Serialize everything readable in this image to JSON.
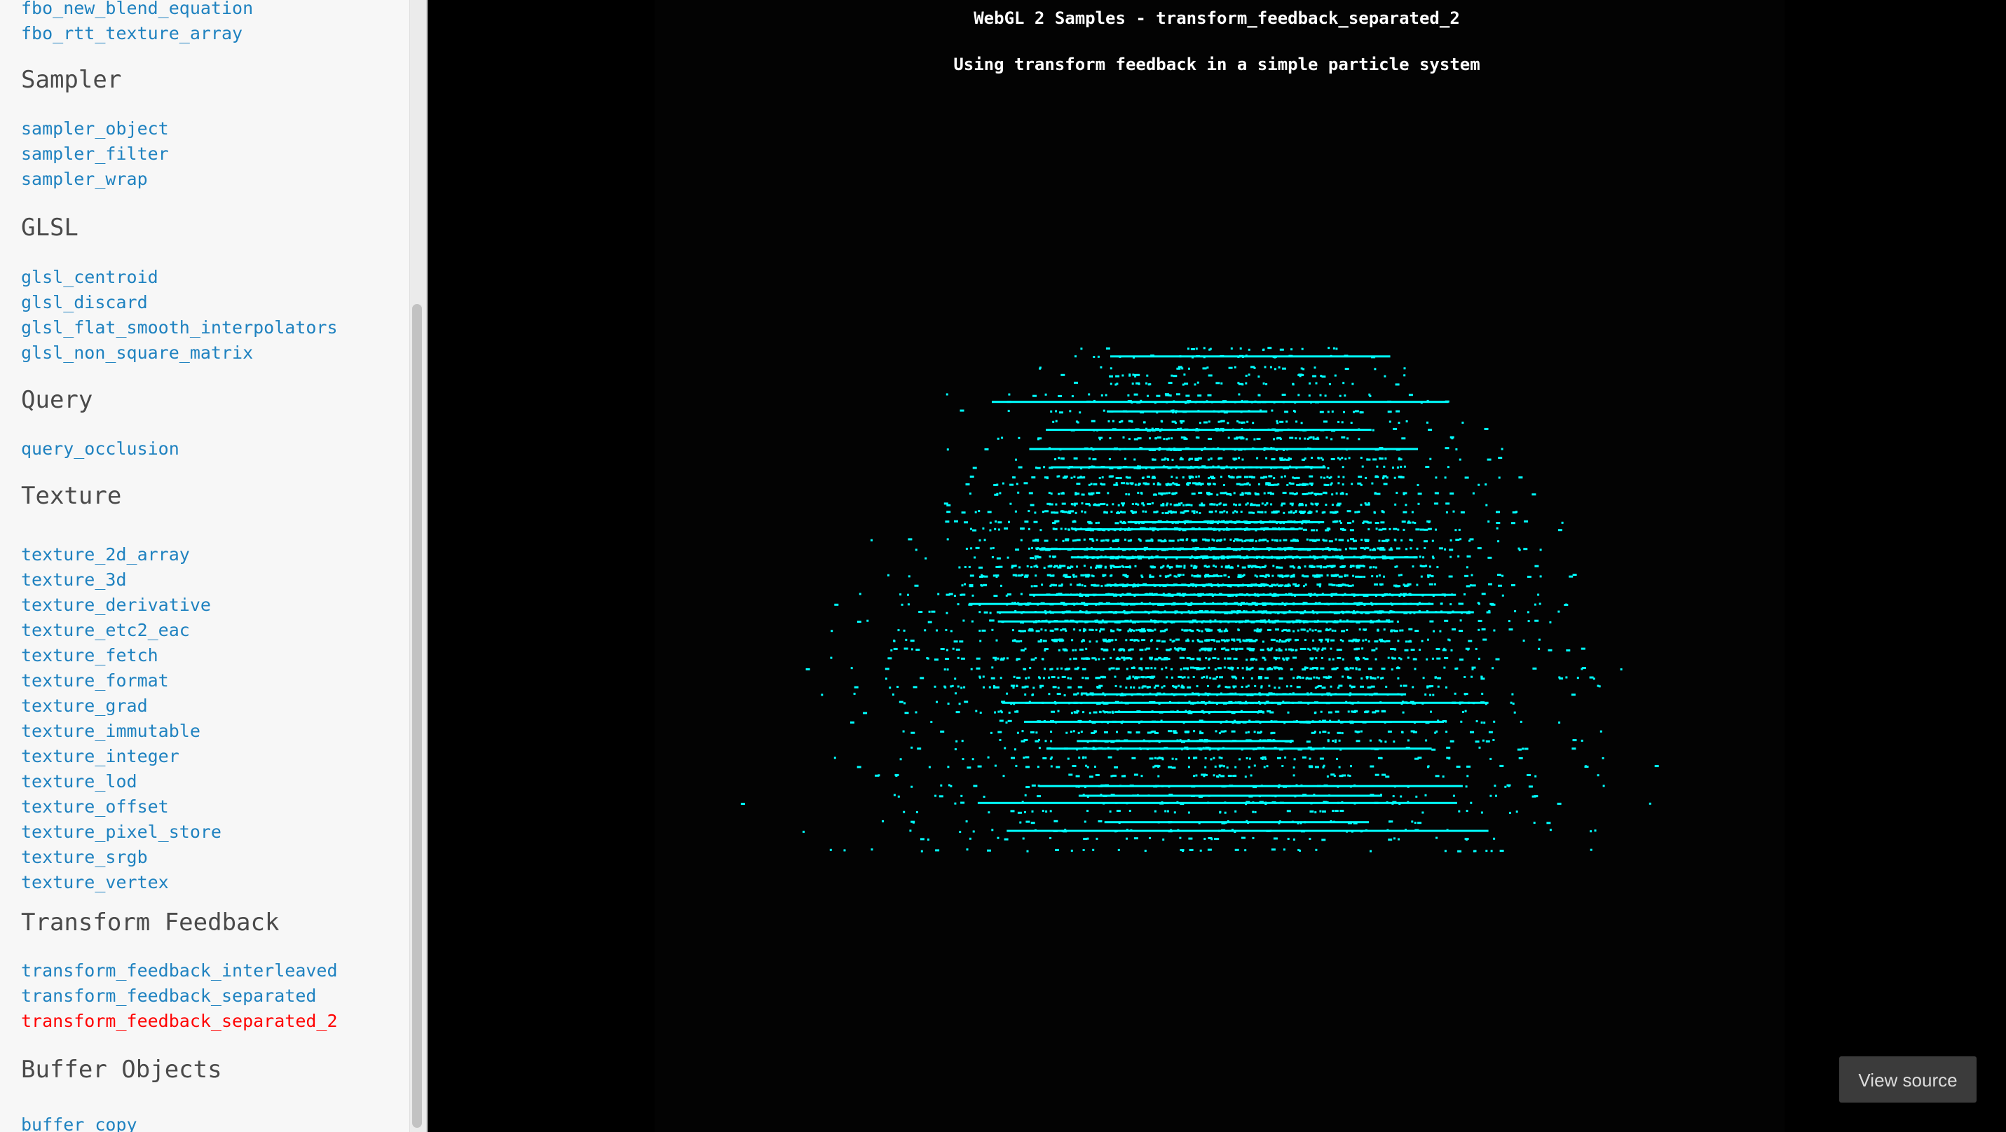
{
  "sidebar": {
    "sections": [
      {
        "title": "",
        "items": [
          {
            "label": "fbo_new_blend_equation",
            "active": false
          },
          {
            "label": "fbo_rtt_texture_array",
            "active": false
          }
        ]
      },
      {
        "title": "Sampler",
        "items": [
          {
            "label": "sampler_object",
            "active": false
          },
          {
            "label": "sampler_filter",
            "active": false
          },
          {
            "label": "sampler_wrap",
            "active": false
          }
        ]
      },
      {
        "title": "GLSL",
        "items": [
          {
            "label": "glsl_centroid",
            "active": false
          },
          {
            "label": "glsl_discard",
            "active": false
          },
          {
            "label": "glsl_flat_smooth_interpolators",
            "active": false
          },
          {
            "label": "glsl_non_square_matrix",
            "active": false
          }
        ]
      },
      {
        "title": "Query",
        "items": [
          {
            "label": "query_occlusion",
            "active": false
          }
        ]
      },
      {
        "title": "Texture",
        "items": [
          {
            "label": "texture_2d_array",
            "active": false
          },
          {
            "label": "texture_3d",
            "active": false
          },
          {
            "label": "texture_derivative",
            "active": false
          },
          {
            "label": "texture_etc2_eac",
            "active": false
          },
          {
            "label": "texture_fetch",
            "active": false
          },
          {
            "label": "texture_format",
            "active": false
          },
          {
            "label": "texture_grad",
            "active": false
          },
          {
            "label": "texture_immutable",
            "active": false
          },
          {
            "label": "texture_integer",
            "active": false
          },
          {
            "label": "texture_lod",
            "active": false
          },
          {
            "label": "texture_offset",
            "active": false
          },
          {
            "label": "texture_pixel_store",
            "active": false
          },
          {
            "label": "texture_srgb",
            "active": false
          },
          {
            "label": "texture_vertex",
            "active": false
          }
        ]
      },
      {
        "title": "Transform Feedback",
        "items": [
          {
            "label": "transform_feedback_interleaved",
            "active": false
          },
          {
            "label": "transform_feedback_separated",
            "active": false
          },
          {
            "label": "transform_feedback_separated_2",
            "active": true
          }
        ]
      },
      {
        "title": "Buffer Objects",
        "items": [
          {
            "label": "buffer_copy",
            "active": false
          }
        ]
      }
    ]
  },
  "demo": {
    "title": "WebGL 2 Samples - transform_feedback_separated_2",
    "subtitle": "Using transform feedback in a simple particle system"
  },
  "view_source_label": "View source",
  "colors": {
    "link": "#1f82c0",
    "active_link": "#ff0000",
    "particle": "#00ffff",
    "background": "#000000"
  }
}
